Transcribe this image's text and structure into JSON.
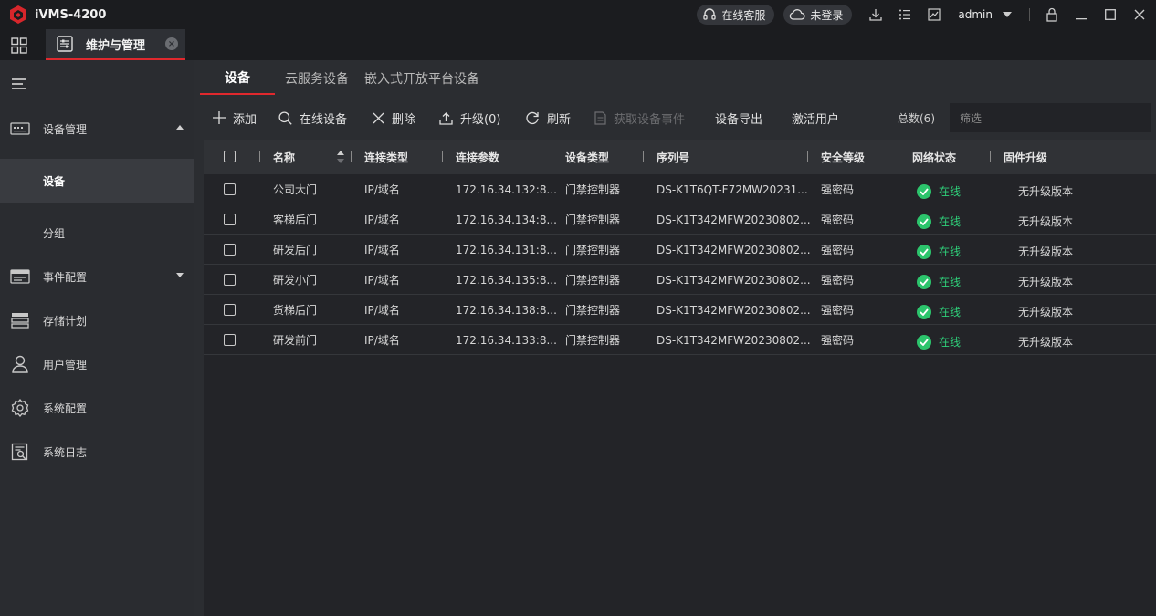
{
  "app": {
    "title": "iVMS-4200",
    "online_service": "在线客服",
    "cloud_login": "未登录",
    "user": "admin"
  },
  "tab": {
    "label": "维护与管理"
  },
  "sidebar": {
    "groups": [
      {
        "label": "设备管理",
        "icon": "device-management-icon",
        "expanded": true
      },
      {
        "label": "事件配置",
        "icon": "event-config-icon",
        "expanded": false
      },
      {
        "label": "存储计划",
        "icon": "storage-plan-icon"
      },
      {
        "label": "用户管理",
        "icon": "user-management-icon"
      },
      {
        "label": "系统配置",
        "icon": "system-config-icon"
      },
      {
        "label": "系统日志",
        "icon": "system-log-icon"
      }
    ],
    "sub_items": [
      {
        "label": "设备",
        "active": true
      },
      {
        "label": "分组",
        "active": false
      }
    ]
  },
  "subtabs": [
    {
      "label": "设备",
      "active": true
    },
    {
      "label": "云服务设备",
      "active": false
    },
    {
      "label": "嵌入式开放平台设备",
      "active": false
    }
  ],
  "toolbar": {
    "add": "添加",
    "online_devices": "在线设备",
    "delete": "删除",
    "upgrade": "升级(0)",
    "refresh": "刷新",
    "get_events": "获取设备事件",
    "export": "设备导出",
    "activate_user": "激活用户",
    "total": "总数(6)",
    "filter_placeholder": "筛选"
  },
  "table": {
    "columns": [
      "名称",
      "连接类型",
      "连接参数",
      "设备类型",
      "序列号",
      "安全等级",
      "网络状态",
      "固件升级"
    ],
    "rows": [
      {
        "name": "公司大门",
        "conn_type": "IP/域名",
        "conn_param": "172.16.34.132:8...",
        "device_type": "门禁控制器",
        "serial": "DS-K1T6QT-F72MW20231...",
        "security": "强密码",
        "status": "在线",
        "firmware": "无升级版本"
      },
      {
        "name": "客梯后门",
        "conn_type": "IP/域名",
        "conn_param": "172.16.34.134:8...",
        "device_type": "门禁控制器",
        "serial": "DS-K1T342MFW20230802...",
        "security": "强密码",
        "status": "在线",
        "firmware": "无升级版本"
      },
      {
        "name": "研发后门",
        "conn_type": "IP/域名",
        "conn_param": "172.16.34.131:8...",
        "device_type": "门禁控制器",
        "serial": "DS-K1T342MFW20230802...",
        "security": "强密码",
        "status": "在线",
        "firmware": "无升级版本"
      },
      {
        "name": "研发小门",
        "conn_type": "IP/域名",
        "conn_param": "172.16.34.135:8...",
        "device_type": "门禁控制器",
        "serial": "DS-K1T342MFW20230802...",
        "security": "强密码",
        "status": "在线",
        "firmware": "无升级版本"
      },
      {
        "name": "货梯后门",
        "conn_type": "IP/域名",
        "conn_param": "172.16.34.138:8...",
        "device_type": "门禁控制器",
        "serial": "DS-K1T342MFW20230802...",
        "security": "强密码",
        "status": "在线",
        "firmware": "无升级版本"
      },
      {
        "name": "研发前门",
        "conn_type": "IP/域名",
        "conn_param": "172.16.34.133:8...",
        "device_type": "门禁控制器",
        "serial": "DS-K1T342MFW20230802...",
        "security": "强密码",
        "status": "在线",
        "firmware": "无升级版本"
      }
    ]
  },
  "colors": {
    "accent": "#e0282d",
    "online": "#2cc46c"
  }
}
